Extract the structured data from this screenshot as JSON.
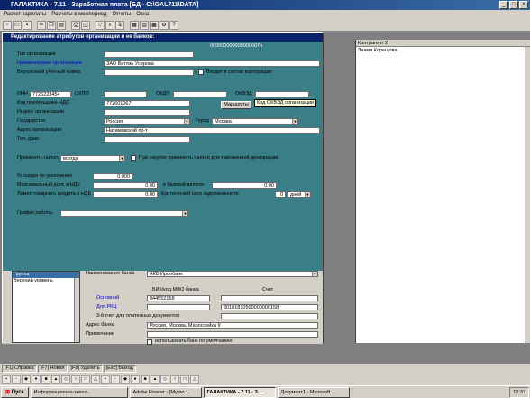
{
  "window": {
    "title": "ГАЛАКТИКА - 7.11 - Заработная плата [БД - C:\\GAL711\\DATA]"
  },
  "menu": [
    "Расчет зарплаты",
    "Расчеты в межпериод",
    "Отчеты",
    "Окна"
  ],
  "form": {
    "title": "Редактирование атрибутов организации и ее банков:",
    "code": "000000000000000007h",
    "labels": {
      "org_type": "Тип организации",
      "org_name": "Наименование организации",
      "internal_no": "Внутренний учетный номер",
      "corp": "Входит в состав корпорации",
      "inn": "ИНН",
      "okpo": "ОКПО",
      "okdp": "ОКДП",
      "okved": "ОКВЭД",
      "vat_code": "Код плательщика НДС",
      "index": "Индекс организации",
      "state": "Государство",
      "city": "Город",
      "address": "Адрес организации",
      "phone": "Тел.,факс",
      "apply_tax": "Применять налоги",
      "tax_on_buy": "При закупке применять налоги для таможенной декларации",
      "discount": "% скидки по умолчанию",
      "max_debt": "Максимальный долг, в НДЕ",
      "in_base": "в базовой валюте",
      "credit_limit": "Лимит товарного кредита в НДЕ",
      "critical": "Критический срок задолженности",
      "schedule": "График работы"
    },
    "values": {
      "org_name": "ЗАО Витязь Усорова",
      "inn": "7726228454",
      "vat_code": "772601067",
      "state": "Россия",
      "city": "Москва",
      "address": "Нахимовский пр-т",
      "apply_tax": "всегда",
      "discount": "0.000",
      "max_debt": "0.00",
      "in_base": "0.00",
      "credit_limit": "0.00",
      "critical_days": "0",
      "critical_unit": "дней"
    },
    "buttons": {
      "routes": "Маршруты"
    },
    "tooltip": "Код ОКВЭД организации"
  },
  "bank": {
    "group_header": "Группа",
    "group_item": "Верхний уровень",
    "labels": {
      "name": "Наименование банка",
      "bik": "БИК/код МФО банка",
      "account": "Счет",
      "main": "Основной",
      "rkc": "Для РКЦ",
      "third": "3-й счет для платежных документов",
      "address": "Адрес банка",
      "note": "Примечание",
      "default": "использовать банк по умолчанию"
    },
    "values": {
      "name": "АКБ Иронбанк",
      "bik": "044552158",
      "rkc_account": "30101810500000000158",
      "address": "Россия, Москва, Мароссейка 9"
    }
  },
  "right_panel": {
    "header": "Контрагент 2",
    "item": "Знамя Корещова"
  },
  "statusbar": [
    "[F1] Справка",
    "[F7] Новая",
    "[F8] Удалить",
    "[Esc] Выход"
  ],
  "taskbar": {
    "start": "Пуск",
    "tasks": [
      "Информационно-техно...",
      "Adobe Reader - [Му по ...",
      "ГАЛАКТИКА - 7.11 - З...",
      "Документ1 - Microsoft ..."
    ],
    "time": "12:37"
  }
}
